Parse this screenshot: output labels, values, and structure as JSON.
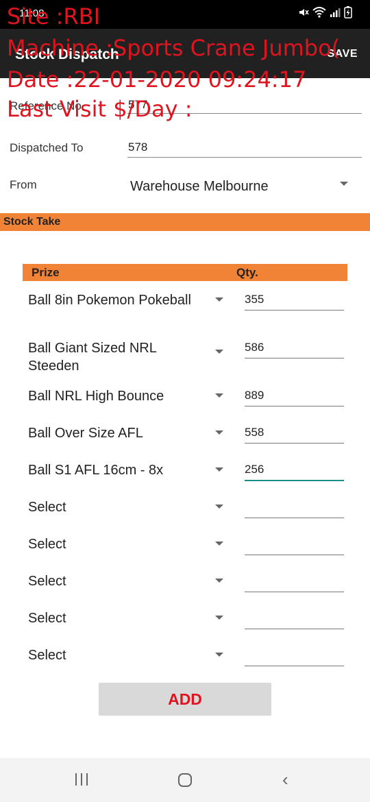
{
  "status_bar": {
    "time": "11:08",
    "icons": [
      "mute-icon",
      "wifi-icon",
      "signal-icon",
      "battery-icon"
    ]
  },
  "app_bar": {
    "title": "Stock Dispatch",
    "save_label": "SAVE"
  },
  "overlay": {
    "site": "Site :RBI",
    "machine": "Machine :Sports Crane Jumbo(",
    "date": "Date :22-01-2020 09:24:17",
    "last_visit": "Last Visit $/Day :"
  },
  "form": {
    "reference_label": "Reference No",
    "reference_value": "577",
    "dispatched_to_label": "Dispatched To",
    "dispatched_to_value": "578",
    "from_label": "From",
    "from_value": "Warehouse Melbourne"
  },
  "section": {
    "title": "Stock Take"
  },
  "table": {
    "prize_header": "Prize",
    "qty_header": "Qty.",
    "rows": [
      {
        "prize": "Ball 8in Pokemon Pokeball",
        "qty": "355"
      },
      {
        "prize": "Ball Giant Sized NRL Steeden",
        "qty": "586"
      },
      {
        "prize": "Ball NRL High Bounce",
        "qty": "889"
      },
      {
        "prize": "Ball Over Size AFL",
        "qty": "558"
      },
      {
        "prize": "Ball S1 AFL 16cm - 8x",
        "qty": "256"
      },
      {
        "prize": "Select",
        "qty": ""
      },
      {
        "prize": "Select",
        "qty": ""
      },
      {
        "prize": "Select",
        "qty": ""
      },
      {
        "prize": "Select",
        "qty": ""
      },
      {
        "prize": "Select",
        "qty": ""
      }
    ]
  },
  "add_button": {
    "label": "ADD"
  },
  "colors": {
    "accent_orange": "#f08336",
    "overlay_red": "#e0141e",
    "focus_teal": "#1a8f8a",
    "app_bar": "#212121"
  }
}
